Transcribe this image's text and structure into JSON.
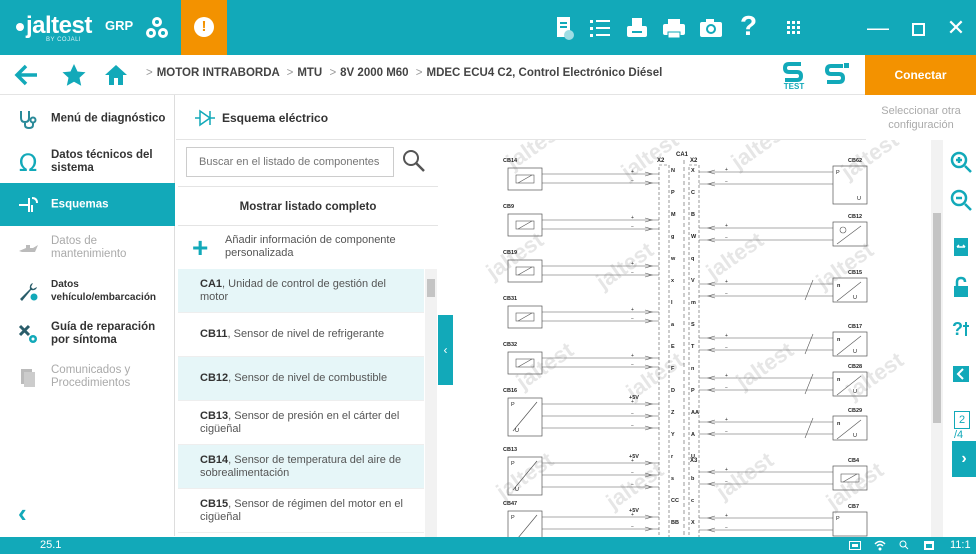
{
  "topbar": {
    "logo": "jaltest",
    "logo_sub": "BY COJALI",
    "grp": "GRP",
    "warning": "!",
    "icons": [
      "document-icon",
      "list-icon",
      "print-setup-icon",
      "printer-icon",
      "camera-icon",
      "help-icon",
      "grid-icon",
      "minimize-icon",
      "maximize-icon",
      "close-icon"
    ],
    "help": "?"
  },
  "nav": {
    "breadcrumb": [
      "MOTOR INTRABORDA",
      "MTU",
      "8V 2000 M60",
      "MDEC ECU4 C2, Control Electrónico Diésel"
    ],
    "test_label": "TEST",
    "connect": "Conectar"
  },
  "sidebar": {
    "items": [
      {
        "label": "Menú de diagnóstico",
        "icon": "stethoscope-icon"
      },
      {
        "label": "Datos técnicos del sistema",
        "icon": "omega-icon"
      },
      {
        "label": "Esquemas",
        "icon": "schematic-icon",
        "active": true
      },
      {
        "label": "Datos de mantenimiento",
        "icon": "oil-can-icon",
        "disabled": true
      },
      {
        "label": "Datos vehículo/embarcación",
        "icon": "wrench-gear-icon"
      },
      {
        "label": "Guía de reparación por síntoma",
        "icon": "tools-gear-icon"
      },
      {
        "label": "Comunicados y Procedimientos",
        "icon": "document-stack-icon",
        "disabled": true
      }
    ]
  },
  "toolbar": {
    "title": "Esquema eléctrico",
    "select_config": "Seleccionar otra configuración"
  },
  "search": {
    "placeholder": "Buscar en el listado de componentes"
  },
  "list": {
    "show_all": "Mostrar listado completo",
    "add_info": "Añadir información de componente personalizada",
    "components": [
      {
        "code": "CA1",
        "desc": ", Unidad de control de gestión del motor"
      },
      {
        "code": "CB11",
        "desc": ", Sensor de nivel de refrigerante"
      },
      {
        "code": "CB12",
        "desc": ", Sensor de nivel de combustible"
      },
      {
        "code": "CB13",
        "desc": ", Sensor de presión en el cárter del cigüeñal"
      },
      {
        "code": "CB14",
        "desc": ", Sensor de temperatura del aire de sobrealimentación"
      },
      {
        "code": "CB15",
        "desc": ", Sensor de régimen del motor en el cigüeñal"
      }
    ]
  },
  "diagram": {
    "watermark": "jaltest",
    "connectors": {
      "x2_left": "X2",
      "ca1": "CA1",
      "x2_right": "X2",
      "x3": "X3"
    },
    "left_labels": [
      "CB14",
      "CB9",
      "CB19",
      "CB31",
      "CB32",
      "CB16",
      "CB13",
      "CB47"
    ],
    "right_labels": [
      "CB62",
      "CB12",
      "CB15",
      "CB17",
      "CB28",
      "CB29",
      "CB4",
      "CB7"
    ],
    "left_pins": [
      "N",
      "P",
      "M",
      "g",
      "w",
      "x",
      "I",
      "a",
      "E",
      "F",
      "D",
      "Z",
      "Y",
      "r",
      "s",
      "CC",
      "BB"
    ],
    "right_pins": [
      "X",
      "C",
      "B",
      "W",
      "q",
      "V",
      "m",
      "S",
      "T",
      "n",
      "P",
      "AA",
      "A",
      "U",
      "b",
      "c",
      "X"
    ],
    "volt": "+5V",
    "pu": [
      "P",
      "U"
    ],
    "n_label": "n"
  },
  "page": {
    "current": "2",
    "total": "/4"
  },
  "status": {
    "version": "25.1",
    "time": "11:1"
  }
}
